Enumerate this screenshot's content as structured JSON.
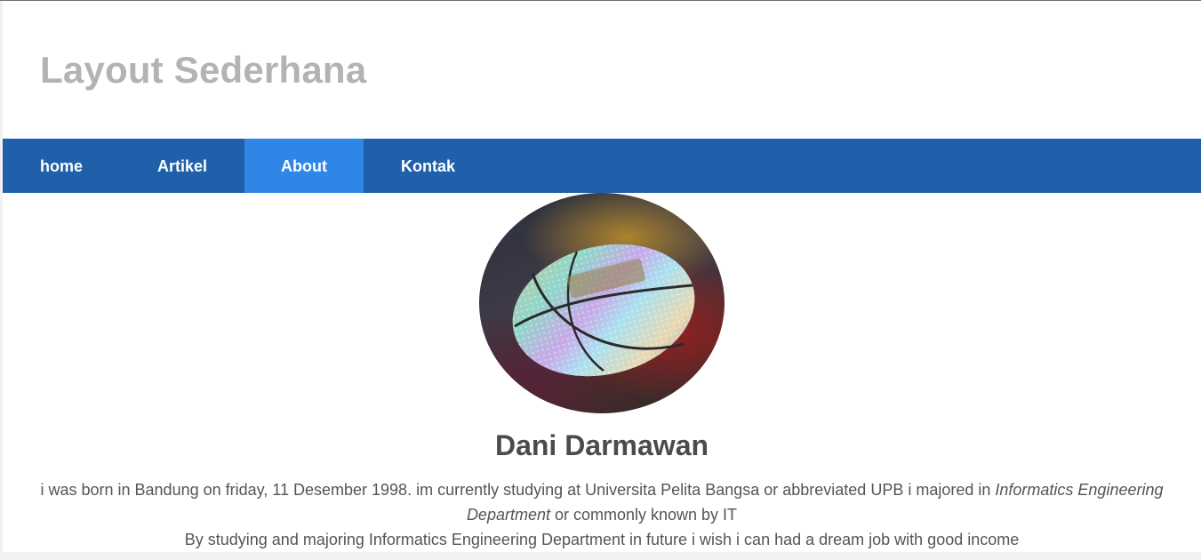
{
  "header": {
    "title": "Layout Sederhana"
  },
  "nav": {
    "items": [
      {
        "label": "home"
      },
      {
        "label": "Artikel"
      },
      {
        "label": "About"
      },
      {
        "label": "Kontak"
      }
    ],
    "active": "About",
    "colors": {
      "bar": "#2060aa",
      "active": "#2e86e6"
    }
  },
  "profile": {
    "name": "Dani Darmawan",
    "bio_line1_a": "i was born in Bandung on friday, 11 Desember 1998. im currently studying at Universita Pelita Bangsa or abbreviated UPB i majored in ",
    "bio_line1_em": "Informatics Engineering Department",
    "bio_line1_b": " or commonly known by IT",
    "bio_line2": "By studying and majoring Informatics Engineering Department in future i wish i can had a dream job with good income",
    "photo": "basketball-photo"
  }
}
